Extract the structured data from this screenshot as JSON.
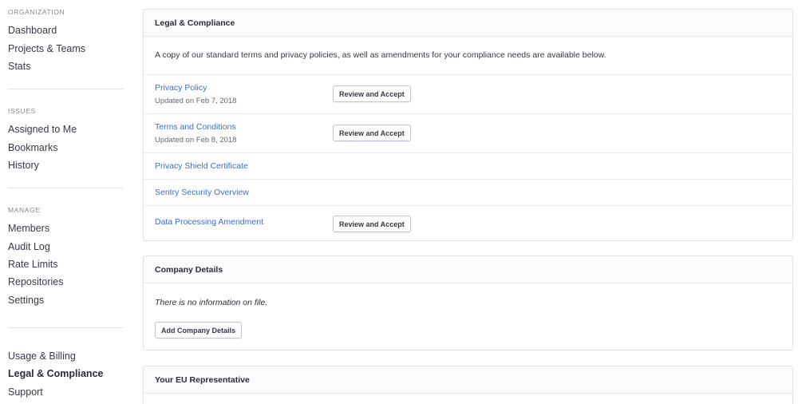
{
  "sidebar": {
    "sections": [
      {
        "title": "ORGANIZATION",
        "items": [
          "Dashboard",
          "Projects & Teams",
          "Stats"
        ]
      },
      {
        "title": "ISSUES",
        "items": [
          "Assigned to Me",
          "Bookmarks",
          "History"
        ]
      },
      {
        "title": "MANAGE",
        "items": [
          "Members",
          "Audit Log",
          "Rate Limits",
          "Repositories",
          "Settings"
        ]
      },
      {
        "title": "",
        "items": [
          "Usage & Billing",
          "Legal & Compliance",
          "Support"
        ]
      }
    ],
    "active_item": "Legal & Compliance"
  },
  "legal": {
    "title": "Legal & Compliance",
    "intro": "A copy of our standard terms and privacy policies, as well as amendments for your compliance needs are available below.",
    "documents": [
      {
        "name": "Privacy Policy",
        "updated": "Updated on Feb 7, 2018",
        "action": "Review and Accept"
      },
      {
        "name": "Terms and Conditions",
        "updated": "Updated on Feb 8, 2018",
        "action": "Review and Accept"
      },
      {
        "name": "Privacy Shield Certificate"
      },
      {
        "name": "Sentry Security Overview"
      },
      {
        "name": "Data Processing Amendment",
        "action": "Review and Accept"
      }
    ]
  },
  "company": {
    "title": "Company Details",
    "empty_text": "There is no information on file.",
    "add_button": "Add Company Details"
  },
  "eu_rep": {
    "title": "Your EU Representative"
  },
  "colors": {
    "link": "#3b6ecc",
    "text": "#2f2936",
    "border": "#e2dee6"
  }
}
